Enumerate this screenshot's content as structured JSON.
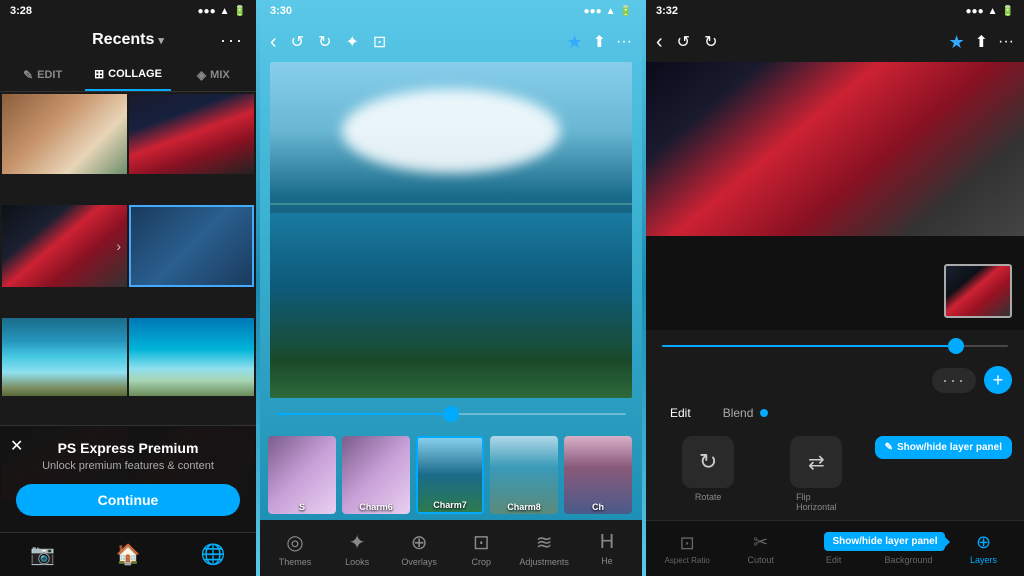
{
  "panel1": {
    "status": {
      "time": "3:28",
      "signal": "●●●",
      "wifi": "▲",
      "battery": "▓"
    },
    "header": {
      "title": "Recents",
      "chevron": "▾",
      "menu": "···"
    },
    "tabs": [
      {
        "id": "edit",
        "label": "EDIT",
        "icon": "✎",
        "active": false
      },
      {
        "id": "collage",
        "label": "COLLAGE",
        "icon": "⊞",
        "active": true
      },
      {
        "id": "mix",
        "label": "MIX",
        "icon": "◈",
        "active": false
      }
    ],
    "premium": {
      "title": "PS Express Premium",
      "subtitle": "Unlock premium features & content",
      "button": "Continue"
    },
    "bottom_icons": [
      "📷",
      "🏠",
      "🌐"
    ]
  },
  "panel2": {
    "status": {
      "time": "3:30",
      "signal": "●●●",
      "wifi": "▲",
      "battery": "▓"
    },
    "toolbar_left": [
      "←",
      "↺",
      "↻",
      "✦",
      "★"
    ],
    "toolbar_right": [
      "⊡",
      "⬆",
      "···"
    ],
    "filters": [
      {
        "id": "s5",
        "label": "S",
        "class": "ft1"
      },
      {
        "id": "charm6",
        "label": "Charm6",
        "class": "ft1"
      },
      {
        "id": "charm7",
        "label": "Charm7",
        "class": "ft2",
        "selected": true
      },
      {
        "id": "charm8",
        "label": "Charm8",
        "class": "ft3"
      },
      {
        "id": "charm9",
        "label": "Ch",
        "class": "ft4"
      }
    ],
    "tools": [
      {
        "icon": "◎",
        "label": "Themes"
      },
      {
        "icon": "✦",
        "label": "Looks"
      },
      {
        "icon": "⊕",
        "label": "Overlays"
      },
      {
        "icon": "⊡",
        "label": "Crop"
      },
      {
        "icon": "≋",
        "label": "Adjustments"
      },
      {
        "icon": "H",
        "label": "He"
      }
    ]
  },
  "panel3": {
    "status": {
      "time": "3:32",
      "signal": "●●●",
      "wifi": "▲",
      "battery": "▓"
    },
    "toolbar_left": [
      "←",
      "↺",
      "↻"
    ],
    "toolbar_right": [
      "★",
      "⬆",
      "···"
    ],
    "edit_blend": [
      {
        "id": "edit",
        "label": "Edit",
        "active": true
      },
      {
        "id": "blend",
        "label": "Blend",
        "active": false,
        "dot": true
      }
    ],
    "actions": [
      {
        "id": "rotate",
        "icon": "↻",
        "label": "Rotate"
      },
      {
        "id": "flip",
        "icon": "⇄",
        "label": "Flip\nHorizontal"
      },
      {
        "id": "show-hide",
        "label": "Show/hide layer panel",
        "special": true
      }
    ],
    "bottom_tools": [
      {
        "id": "aspect-ratio",
        "icon": "⊡",
        "label": "Aspect Ratio",
        "active": false
      },
      {
        "id": "cutout",
        "icon": "✂",
        "label": "Cutout",
        "active": false
      },
      {
        "id": "edit",
        "icon": "✎",
        "label": "Edit",
        "active": false
      },
      {
        "id": "background",
        "icon": "◧",
        "label": "Background",
        "active": false
      },
      {
        "id": "layers",
        "icon": "⊕",
        "label": "Layers",
        "active": true
      }
    ],
    "tooltip": "Show/hide layer panel"
  }
}
